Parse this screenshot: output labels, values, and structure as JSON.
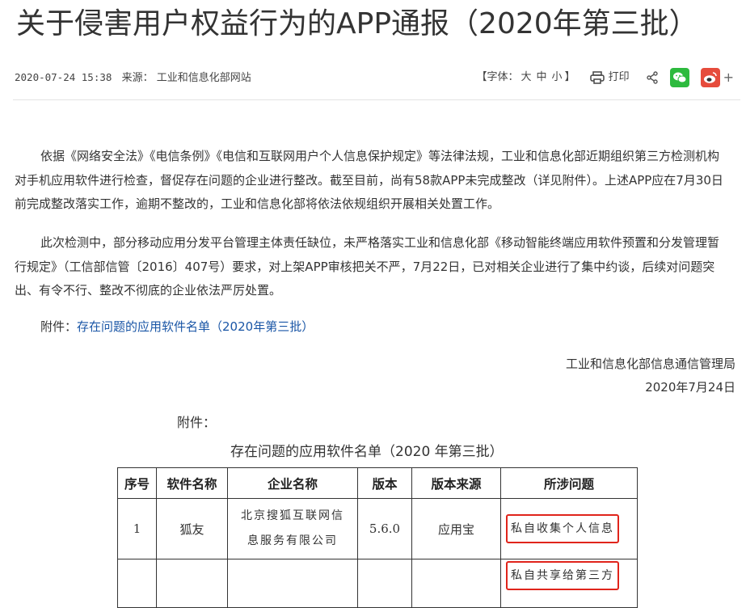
{
  "article": {
    "title": "关于侵害用户权益行为的APP通报（2020年第三批）",
    "date": "2020-07-24 15:38",
    "source": "来源： 工业和信息化部网站",
    "font_label": "【字体：",
    "font_large": "大",
    "font_medium": "中",
    "font_small": "小",
    "font_close": "】",
    "print_label": "打印",
    "paragraph1": "依据《网络安全法》《电信条例》《电信和互联网用户个人信息保护规定》等法律法规，工业和信息化部近期组织第三方检测机构对手机应用软件进行检查，督促存在问题的企业进行整改。截至目前，尚有58款APP未完成整改（详见附件）。上述APP应在7月30日前完成整改落实工作，逾期不整改的，工业和信息化部将依法依规组织开展相关处置工作。",
    "paragraph2": "此次检测中，部分移动应用分发平台管理主体责任缺位，未严格落实工业和信息化部《移动智能终端应用软件预置和分发管理暂行规定》（工信部信管〔2016〕407号）要求，对上架APP审核把关不严，7月22日，已对相关企业进行了集中约谈，后续对问题突出、有令不行、整改不彻底的企业依法严厉处置。",
    "attachment_prefix": "附件：",
    "attachment_link": "存在问题的应用软件名单（2020年第三批）",
    "signature_org": "工业和信息化部信息通信管理局",
    "signature_date": "2020年7月24日"
  },
  "attachment": {
    "label": "附件：",
    "table_title": "存在问题的应用软件名单（2020 年第三批）",
    "headers": [
      "序号",
      "软件名称",
      "企业名称",
      "版本",
      "版本来源",
      "所涉问题"
    ],
    "rows": [
      {
        "no": "1",
        "name": "狐友",
        "company_line1": "北京搜狐互联网信",
        "company_line2": "息服务有限公司",
        "version": "5.6.0",
        "source": "应用宝",
        "issue": "私自收集个人信息"
      },
      {
        "no": "",
        "name": "",
        "company_line1": "",
        "company_line2": "",
        "version": "",
        "source": "",
        "issue": "私自共享给第三方"
      }
    ]
  },
  "colors": {
    "link": "#1a56a6",
    "highlight": "#e0241b",
    "wechat": "#2dba3e",
    "weibo": "#e64c3c"
  },
  "icons": [
    "printer-icon",
    "share-icon",
    "wechat-icon",
    "weibo-icon",
    "plus-icon"
  ]
}
